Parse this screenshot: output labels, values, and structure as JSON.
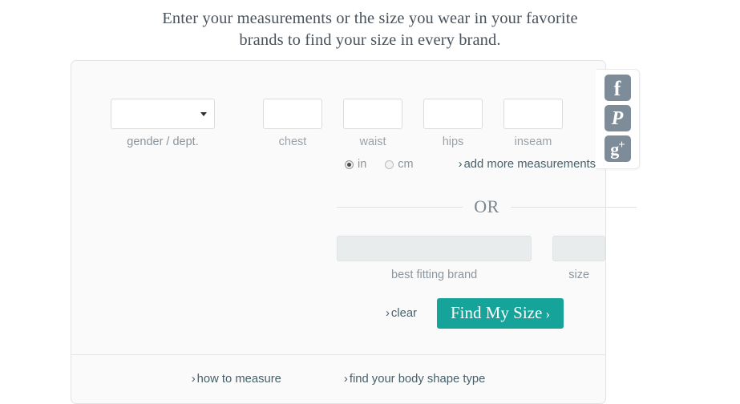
{
  "headline": "Enter your measurements or the size you wear in your favorite brands to find your size in every brand.",
  "form": {
    "gender": {
      "label": "gender / dept.",
      "value": "",
      "placeholder": ""
    },
    "measurements": [
      {
        "name": "chest",
        "label": "chest",
        "value": "",
        "placeholder": ""
      },
      {
        "name": "waist",
        "label": "waist",
        "value": "",
        "placeholder": ""
      },
      {
        "name": "hips",
        "label": "hips",
        "value": "",
        "placeholder": ""
      },
      {
        "name": "inseam",
        "label": "inseam",
        "value": "",
        "placeholder": ""
      }
    ],
    "units": {
      "selected": "in",
      "options": [
        {
          "value": "in",
          "label": "in",
          "checked": true
        },
        {
          "value": "cm",
          "label": "cm",
          "checked": false
        }
      ]
    },
    "add_more_link": "add more measurements",
    "divider_text": "OR",
    "brand": {
      "label": "best fitting brand",
      "value": "",
      "placeholder": "",
      "disabled": true
    },
    "size": {
      "label": "size",
      "value": "",
      "placeholder": "",
      "disabled": true
    },
    "clear_link": "clear",
    "submit_label": "Find My Size",
    "chevron": "›"
  },
  "footer": {
    "links": [
      {
        "label": "how to measure"
      },
      {
        "label": "find your body shape type"
      }
    ]
  },
  "social": {
    "items": [
      {
        "name": "facebook",
        "glyph": "f"
      },
      {
        "name": "pinterest",
        "glyph": "P"
      },
      {
        "name": "googleplus",
        "glyph": "g",
        "plus": "+"
      }
    ]
  },
  "colors": {
    "accent": "#16a39a",
    "link": "#49616a",
    "label": "#8e969c",
    "social_bg": "#7e8c99",
    "card_bg": "#fafafa"
  }
}
